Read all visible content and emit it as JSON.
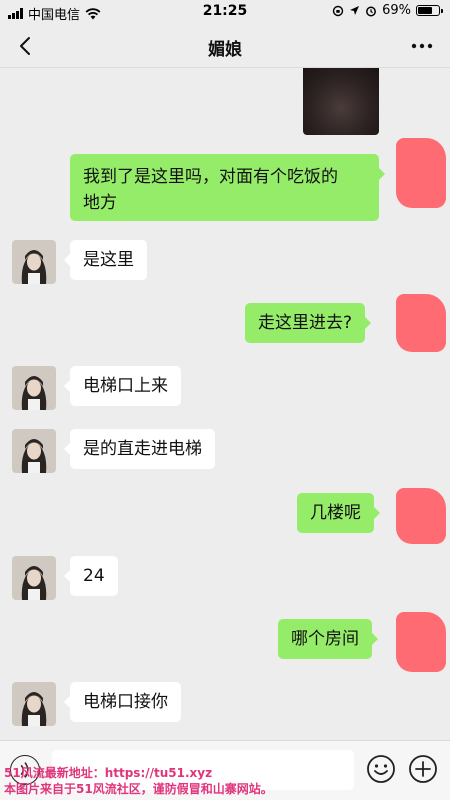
{
  "status_bar": {
    "carrier": "中国电信",
    "time": "21:25",
    "battery_text": "69%",
    "battery_level": 0.69
  },
  "nav": {
    "title": "媚娘",
    "back_icon": "chevron-left-icon",
    "more_icon": "more-dots-icon"
  },
  "messages": [
    {
      "side": "out",
      "type": "image",
      "icon": "photo"
    },
    {
      "side": "out",
      "text": "我到了是这里吗，对面有个吃饭的\n地方"
    },
    {
      "side": "in",
      "text": "是这里"
    },
    {
      "side": "out",
      "text": "走这里进去?"
    },
    {
      "side": "in",
      "text": "电梯口上来"
    },
    {
      "side": "in",
      "text": "是的直走进电梯"
    },
    {
      "side": "out",
      "text": "几楼呢"
    },
    {
      "side": "in",
      "text": "24"
    },
    {
      "side": "out",
      "text": "哪个房间"
    },
    {
      "side": "in",
      "text": "电梯口接你"
    }
  ],
  "input_bar": {
    "voice_icon": "voice-icon",
    "emoji_icon": "emoji-icon",
    "plus_icon": "plus-icon",
    "input_value": ""
  },
  "watermark": {
    "line1": "51风流最新地址：https://tu51.xyz",
    "line2": "本图片来自于51风流社区，谨防假冒和山寨网站。"
  },
  "colors": {
    "background": "#ededed",
    "outgoing_bubble": "#95ec69",
    "incoming_bubble": "#ffffff",
    "redaction": "#ff6b72",
    "watermark": "#e0357c"
  }
}
